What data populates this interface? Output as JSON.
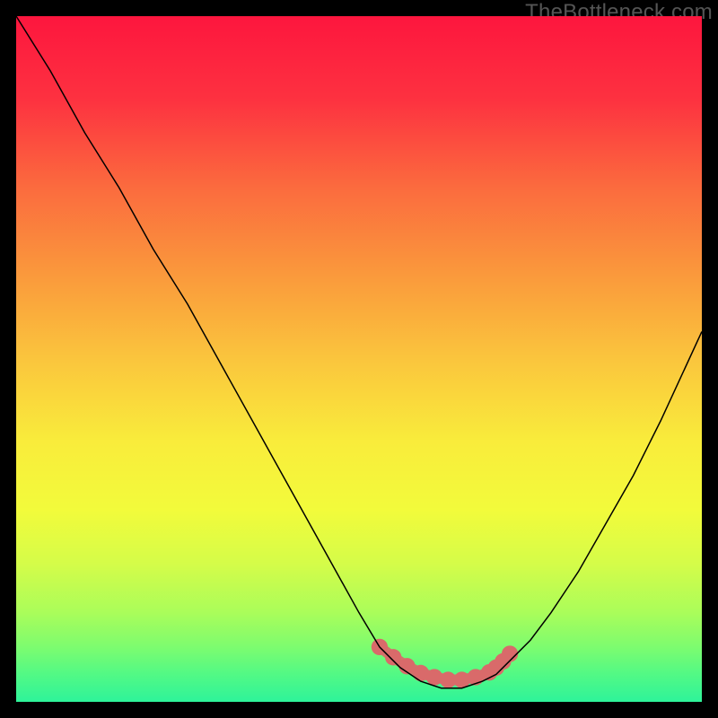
{
  "attribution": "TheBottleneck.com",
  "chart_data": {
    "type": "line",
    "title": "",
    "xlabel": "",
    "ylabel": "",
    "xlim": [
      0,
      100
    ],
    "ylim": [
      0,
      100
    ],
    "background_gradient": {
      "stops": [
        {
          "offset": 0.0,
          "color": "#fd163e"
        },
        {
          "offset": 0.12,
          "color": "#fd3140"
        },
        {
          "offset": 0.25,
          "color": "#fb6b3e"
        },
        {
          "offset": 0.38,
          "color": "#fa9a3c"
        },
        {
          "offset": 0.5,
          "color": "#fac53d"
        },
        {
          "offset": 0.62,
          "color": "#f9ec3b"
        },
        {
          "offset": 0.72,
          "color": "#f2fb3b"
        },
        {
          "offset": 0.8,
          "color": "#d4fc49"
        },
        {
          "offset": 0.87,
          "color": "#aafd5a"
        },
        {
          "offset": 0.92,
          "color": "#7dfc6f"
        },
        {
          "offset": 0.96,
          "color": "#52f985"
        },
        {
          "offset": 1.0,
          "color": "#2ef39a"
        }
      ]
    },
    "series": [
      {
        "name": "bottleneck-curve",
        "color": "#000000",
        "width": 1.5,
        "x": [
          0,
          5,
          10,
          15,
          20,
          25,
          30,
          35,
          40,
          45,
          50,
          53,
          56,
          59,
          62,
          65,
          68,
          70,
          72,
          75,
          78,
          82,
          86,
          90,
          94,
          100
        ],
        "y": [
          100,
          92,
          83,
          75,
          66,
          58,
          49,
          40,
          31,
          22,
          13,
          8,
          5,
          3,
          2,
          2,
          3,
          4,
          6,
          9,
          13,
          19,
          26,
          33,
          41,
          54
        ]
      }
    ],
    "accent_band": {
      "name": "minimum-region",
      "color": "#d96a6a",
      "points_x": [
        53,
        55,
        57,
        59,
        61,
        63,
        65,
        67,
        69,
        70,
        71,
        72
      ],
      "points_y": [
        8,
        6.5,
        5.2,
        4.2,
        3.6,
        3.2,
        3.2,
        3.6,
        4.3,
        5.0,
        5.9,
        7.0
      ]
    }
  }
}
